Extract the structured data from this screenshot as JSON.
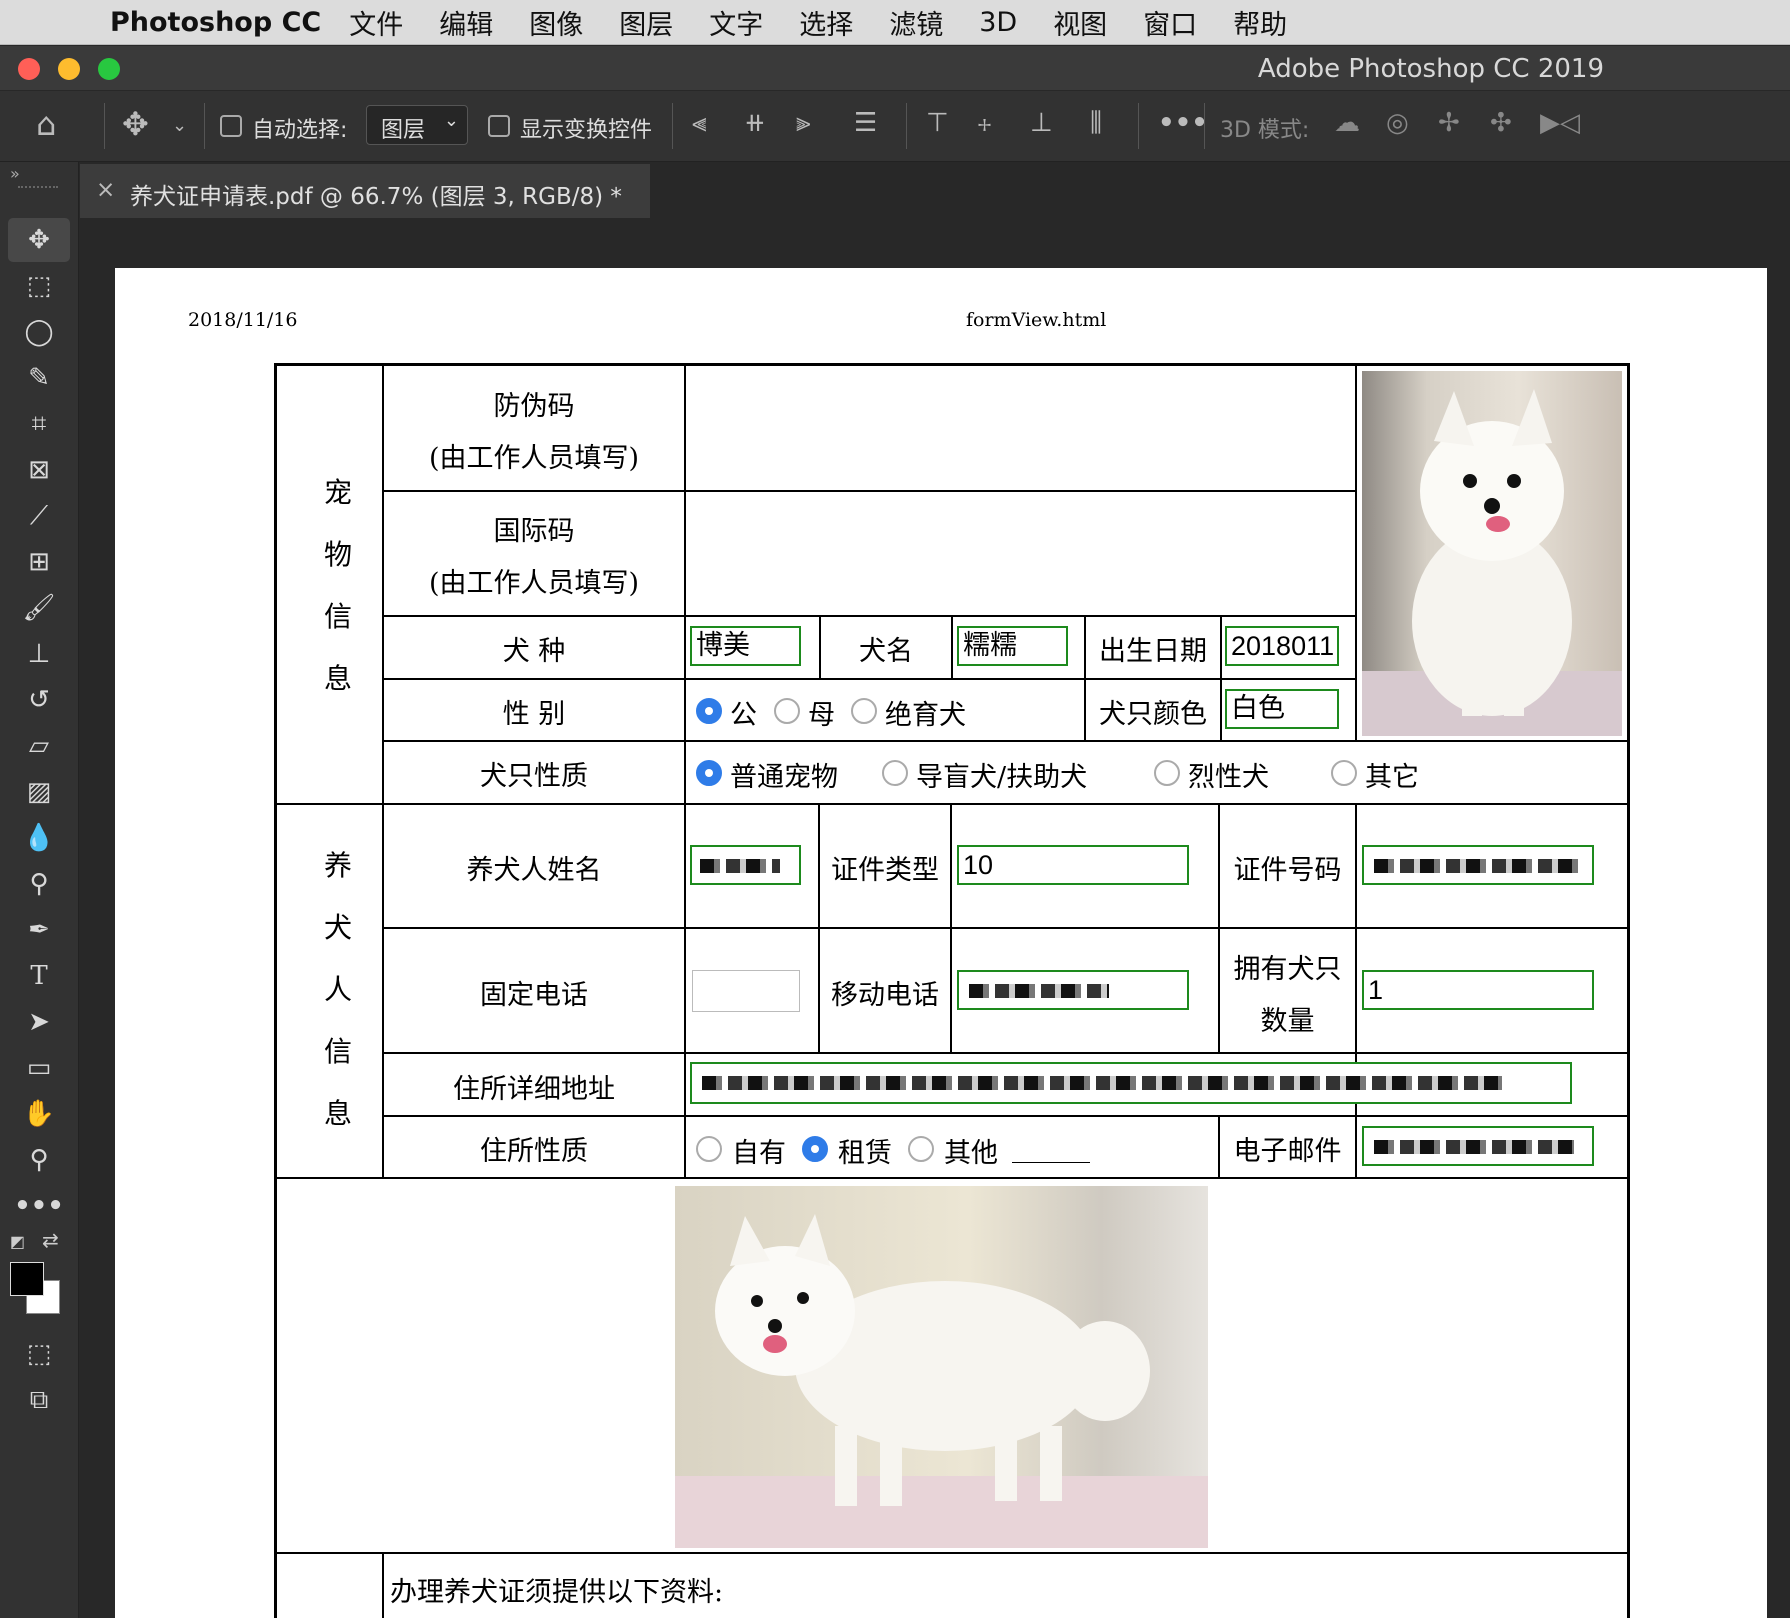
{
  "menubar": {
    "app_name": "Photoshop CC",
    "items": [
      "文件",
      "编辑",
      "图像",
      "图层",
      "文字",
      "选择",
      "滤镜",
      "3D",
      "视图",
      "窗口",
      "帮助"
    ]
  },
  "window": {
    "title": "Adobe Photoshop CC 2019"
  },
  "options_bar": {
    "auto_select_label": "自动选择:",
    "auto_select_value": "图层",
    "show_transform_label": "显示变换控件",
    "mode_3d_label": "3D 模式:"
  },
  "document_tab": {
    "title": "养犬证申请表.pdf @ 66.7% (图层 3, RGB/8) *"
  },
  "page": {
    "date": "2018/11/16",
    "file": "formView.html",
    "pet_section_label": [
      "宠",
      "物",
      "信",
      "息"
    ],
    "owner_section_label": [
      "养",
      "犬",
      "人",
      "信",
      "息"
    ],
    "anti_fake_code": "防伪码",
    "intl_code": "国际码",
    "staff_fill": "(由工作人员填写)",
    "breed_label": "犬 种",
    "breed_value": "博美",
    "dog_name_label": "犬名",
    "dog_name_value": "糯糯",
    "birth_label": "出生日期",
    "birth_value": "2018011",
    "sex_label": "性 别",
    "sex_options": [
      "公",
      "母",
      "绝育犬"
    ],
    "sex_selected": "公",
    "color_label": "犬只颜色",
    "color_value": "白色",
    "nature_label": "犬只性质",
    "nature_options": [
      "普通宠物",
      "导盲犬/扶助犬",
      "烈性犬",
      "其它"
    ],
    "nature_selected": "普通宠物",
    "owner_name_label": "养犬人姓名",
    "id_type_label": "证件类型",
    "id_type_value": "10",
    "id_number_label": "证件号码",
    "landline_label": "固定电话",
    "landline_value": "",
    "mobile_label": "移动电话",
    "dog_count_label_1": "拥有犬只",
    "dog_count_label_2": "数量",
    "dog_count_value": "1",
    "address_label": "住所详细地址",
    "residence_label": "住所性质",
    "residence_options": [
      "自有",
      "租赁",
      "其他"
    ],
    "residence_selected": "租赁",
    "email_label": "电子邮件",
    "docs_required": "办理养犬证须提供以下资料:"
  },
  "colors": {
    "accent_radio": "#2f7ce8",
    "input_border": "#1d8a1d",
    "close_light": "#ff5f57",
    "minimize_light": "#febc2e",
    "zoom_light": "#28c840"
  }
}
